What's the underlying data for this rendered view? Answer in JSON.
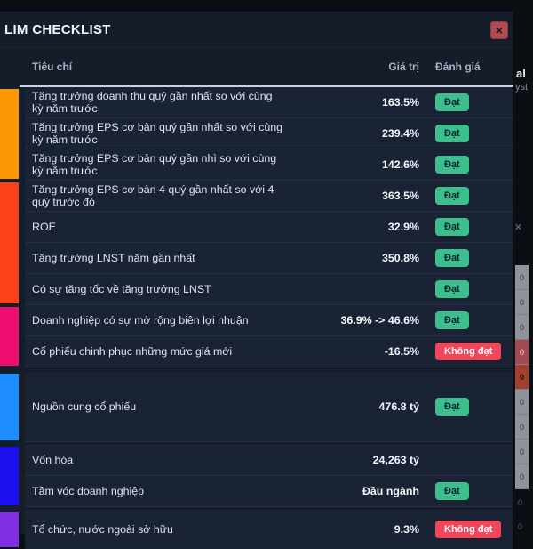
{
  "modal": {
    "title": "LIM CHECKLIST",
    "close_glyph": "×",
    "columns": {
      "criteria": "Tiêu chí",
      "value": "Giá trị",
      "rating": "Đánh giá"
    },
    "colors": {
      "pass_bg": "#3cbf8d",
      "pass_text": "#0f2233",
      "fail_bg": "#f0475c",
      "fail_text": "#ffffff"
    },
    "groups": [
      {
        "color": "#fb9804",
        "rows": [
          {
            "label": "Tăng trưởng doanh thu quý gần nhất so với cùng kỳ năm trước",
            "value": "163.5%",
            "badge": "Đạt",
            "status": "pass"
          },
          {
            "label": "Tăng trưởng EPS cơ bản quý gần nhất so với cùng kỳ năm trước",
            "value": "239.4%",
            "badge": "Đạt",
            "status": "pass"
          },
          {
            "label": "Tăng trưởng EPS cơ bản quý gần nhì so với cùng kỳ năm trước",
            "value": "142.6%",
            "badge": "Đạt",
            "status": "pass"
          }
        ]
      },
      {
        "color": "#fb4217",
        "rows": [
          {
            "label": "Tăng trưởng EPS cơ bản 4 quý gần nhất so với 4 quý trước đó",
            "value": "363.5%",
            "badge": "Đạt",
            "status": "pass"
          },
          {
            "label": "ROE",
            "value": "32.9%",
            "badge": "Đạt",
            "status": "pass"
          },
          {
            "label": "Tăng trưởng LNST năm gần nhất",
            "value": "350.8%",
            "badge": "Đạt",
            "status": "pass"
          },
          {
            "label": "Có sự tăng tốc về tăng trưởng LNST",
            "value": "",
            "badge": "Đạt",
            "status": "pass"
          }
        ]
      },
      {
        "color": "#ee0e6f",
        "rows": [
          {
            "label": "Doanh nghiệp có sự mở rộng biên lợi nhuận",
            "value": "36.9% -> 46.6%",
            "badge": "Đạt",
            "status": "pass"
          },
          {
            "label": "Cổ phiếu chinh phục những mức giá mới",
            "value": "-16.5%",
            "badge": "Không đạt",
            "status": "fail"
          }
        ]
      },
      {
        "color": "#1e8dfd",
        "rows": [
          {
            "label": "Nguồn cung cổ phiếu",
            "value": "476.8 tỷ",
            "badge": "Đạt",
            "status": "pass"
          }
        ]
      },
      {
        "color": "#1a10f0",
        "rows": [
          {
            "label": "Vốn hóa",
            "value": "24,263 tỷ",
            "badge": "",
            "status": "none"
          },
          {
            "label": "Tầm vóc doanh nghiệp",
            "value": "Đầu ngành",
            "badge": "Đạt",
            "status": "pass"
          }
        ]
      },
      {
        "color": "#7e2fe0",
        "rows": [
          {
            "label": "Tổ chức, nước ngoài sở hữu",
            "value": "9.3%",
            "badge": "Không đạt",
            "status": "fail"
          }
        ]
      }
    ]
  },
  "background_page": {
    "fragment_top": "al",
    "fragment_top2": "yst",
    "close_glyph": "×",
    "side_cells": [
      {
        "text": "0",
        "variant": "normal"
      },
      {
        "text": "0",
        "variant": "normal"
      },
      {
        "text": "0",
        "variant": "normal"
      },
      {
        "text": "0",
        "variant": "red1"
      },
      {
        "text": "0",
        "variant": "red2"
      },
      {
        "text": "0",
        "variant": "normal"
      },
      {
        "text": "0",
        "variant": "normal"
      },
      {
        "text": "0",
        "variant": "normal"
      },
      {
        "text": "0",
        "variant": "normal"
      }
    ],
    "below_cells": [
      "0",
      "0"
    ]
  }
}
